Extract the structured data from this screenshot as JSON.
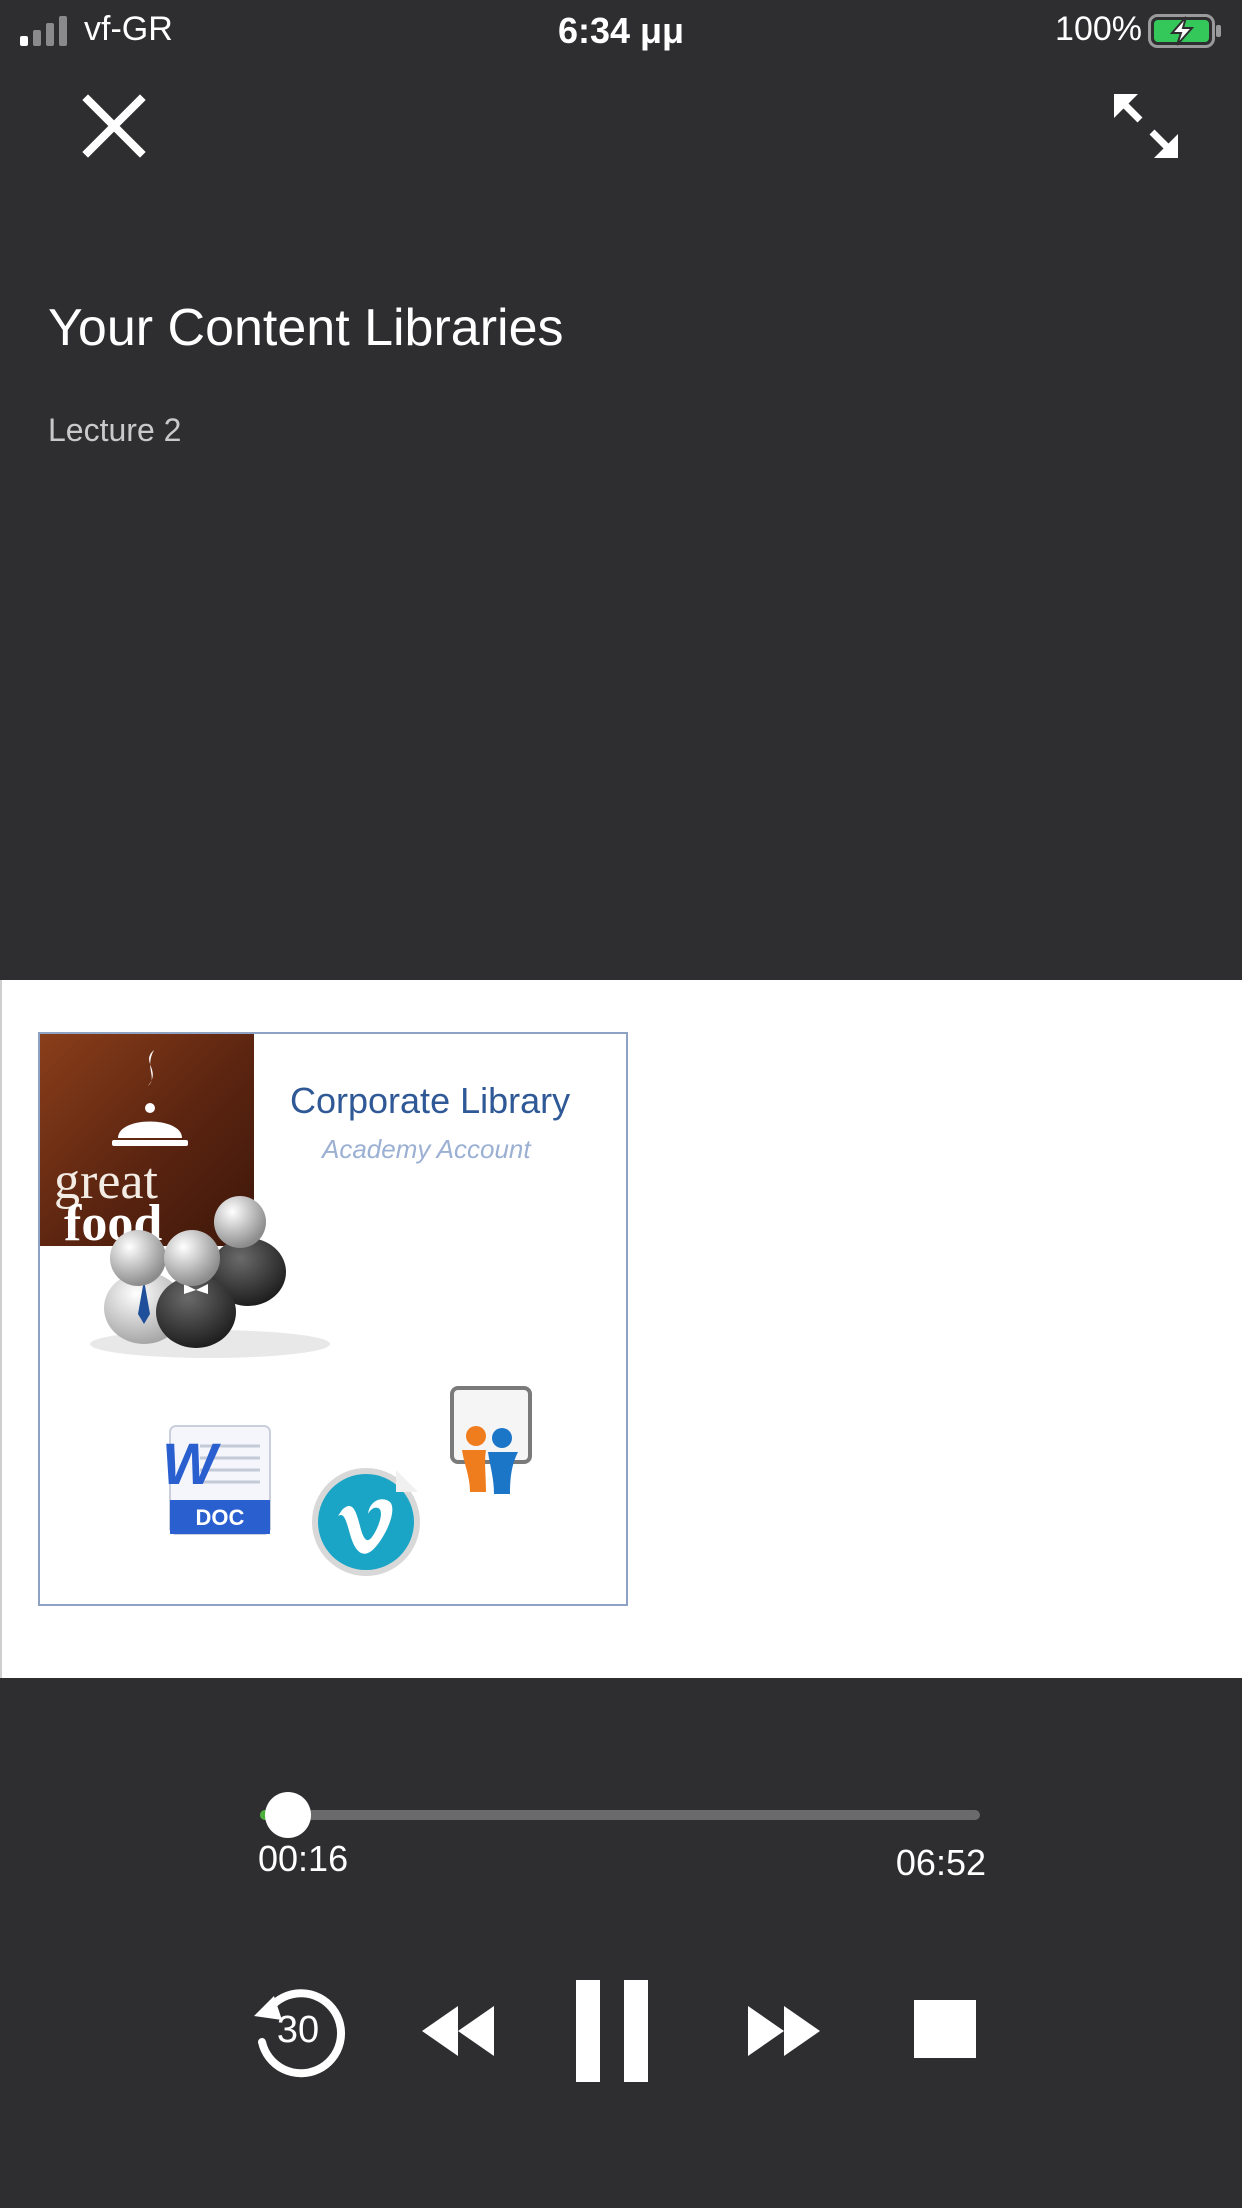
{
  "status_bar": {
    "carrier": "vf-GR",
    "time": "6:34 μμ",
    "battery_percent": "100%"
  },
  "header": {
    "title": "Your Content Libraries",
    "subtitle": "Lecture 2"
  },
  "slide": {
    "logo_line1": "great",
    "logo_line2": "food",
    "title": "Corporate Library",
    "subtitle": "Academy Account",
    "doc_label": "DOC"
  },
  "player": {
    "current_time": "00:16",
    "total_time": "06:52",
    "progress_fraction": 0.039,
    "replay_label": "30"
  },
  "colors": {
    "background": "#2e2e30",
    "progress_accent": "#4bb039",
    "battery_green": "#34c759"
  },
  "icons": {
    "close": "close-icon",
    "expand": "expand-icon",
    "replay": "replay-30-icon",
    "rewind": "rewind-icon",
    "pause": "pause-icon",
    "forward": "fast-forward-icon",
    "stop": "stop-icon"
  }
}
